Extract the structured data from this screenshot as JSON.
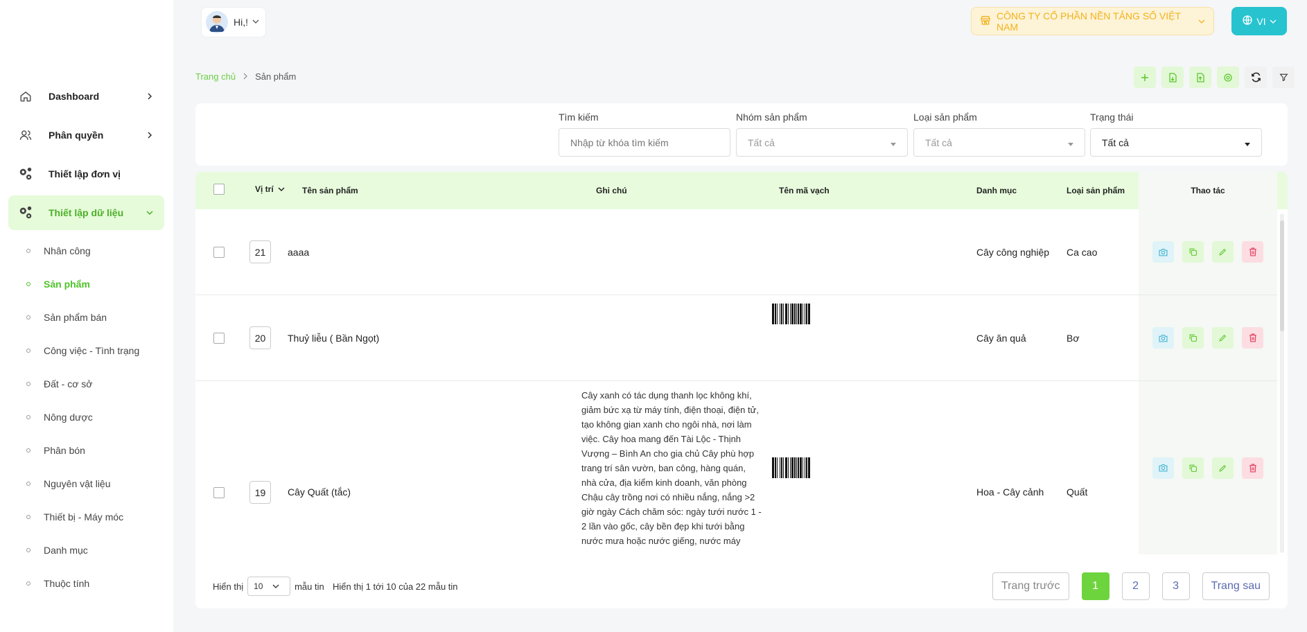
{
  "header": {
    "greeting": "Hi,!",
    "company": "CÔNG TY CỔ PHẦN NỀN TẢNG SỐ VIỆT NAM",
    "language": "VI",
    "accent_green": "#6ed43e",
    "accent_teal": "#27c3cf"
  },
  "sidebar": {
    "items": [
      {
        "label": "Dashboard",
        "icon": "home-icon"
      },
      {
        "label": "Phân quyền",
        "icon": "users-icon"
      },
      {
        "label": "Thiết lập đơn vị",
        "icon": "gears-icon"
      },
      {
        "label": "Thiết lập dữ liệu",
        "icon": "gears-icon"
      }
    ],
    "subitems": [
      "Nhân công",
      "Sản phẩm",
      "Sản phẩm bán",
      "Công việc - Tình trạng",
      "Đất - cơ sở",
      "Nông dược",
      "Phân bón",
      "Nguyên vật liệu",
      "Thiết bị - Máy móc",
      "Danh mục",
      "Thuộc tính"
    ]
  },
  "breadcrumb": {
    "home": "Trang chủ",
    "current": "Sản phẩm"
  },
  "filters": {
    "search_label": "Tìm kiếm",
    "search_placeholder": "Nhập từ khóa tìm kiếm",
    "group_label": "Nhóm sản phẩm",
    "group_value": "Tất cả",
    "type_label": "Loại sản phẩm",
    "type_value": "Tất cả",
    "status_label": "Trạng thái",
    "status_value": "Tất cả"
  },
  "table": {
    "columns": {
      "position": "Vị trí",
      "name": "Tên sản phẩm",
      "note": "Ghi chú",
      "barcode": "Tên mã vạch",
      "category": "Danh mục",
      "type": "Loại sản phẩm",
      "actions": "Thao tác"
    },
    "rows": [
      {
        "position": "21",
        "name": "aaaa",
        "note": "",
        "barcode": false,
        "category": "Cây công nghiệp",
        "type": "Ca cao"
      },
      {
        "position": "20",
        "name": "Thuỷ liễu ( Bần Ngọt)",
        "note": "",
        "barcode": true,
        "category": "Cây ăn quả",
        "type": "Bơ"
      },
      {
        "position": "19",
        "name": "Cây Quất (tắc)",
        "note": "Cây xanh có tác dụng thanh lọc không khí, giảm bức xạ từ máy tính, điện thoại, điện tử, tạo không gian xanh cho ngôi nhà, nơi làm việc. Cây hoa mang đến Tài Lộc - Thịnh Vượng – Bình An cho gia chủ Cây phù hợp trang trí sân vườn, ban công, hàng quán, nhà cửa, địa kiểm kinh doanh, văn phòng Chậu cây trồng nơi có nhiều nắng, nắng >2 giờ ngày Cách chăm sóc: ngày tưới nước 1 - 2 lần vào gốc, cây bền đẹp khi tưới bằng nước mưa hoặc nước giếng, nước máy",
        "barcode": true,
        "category": "Hoa - Cây cảnh",
        "type": "Quất"
      }
    ]
  },
  "footer": {
    "show_label": "Hiển thị",
    "page_size": "10",
    "records_label": "mẫu tin",
    "info": "Hiển thị 1 tới 10 của 22 mẫu tin",
    "prev": "Trang trước",
    "next": "Trang sau",
    "pages": [
      "1",
      "2",
      "3"
    ],
    "current_page": "1"
  }
}
